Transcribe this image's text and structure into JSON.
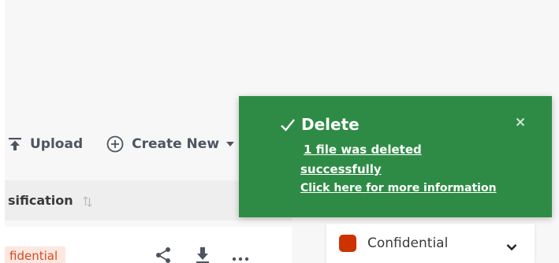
{
  "toolbar": {
    "upload_label": "Upload",
    "create_new_label": "Create New"
  },
  "table": {
    "column_header": "sification",
    "rows": [
      {
        "classification_chip": "fidential"
      }
    ]
  },
  "classification_select": {
    "value": "Confidential",
    "color": "#cc3300"
  },
  "toast": {
    "title": "Delete",
    "message_line1": "1 file was deleted",
    "message_line2": "successfully",
    "more_info_link": "Click here for more information",
    "background": "#2e8b45"
  },
  "icons": {
    "upload": "upload-icon",
    "create": "plus-circle-icon",
    "caret": "caret-down-icon",
    "sort": "sort-icon",
    "share": "share-icon",
    "download": "download-icon",
    "more": "more-icon",
    "check": "check-icon",
    "close": "close-icon",
    "chevron": "chevron-down-icon"
  }
}
